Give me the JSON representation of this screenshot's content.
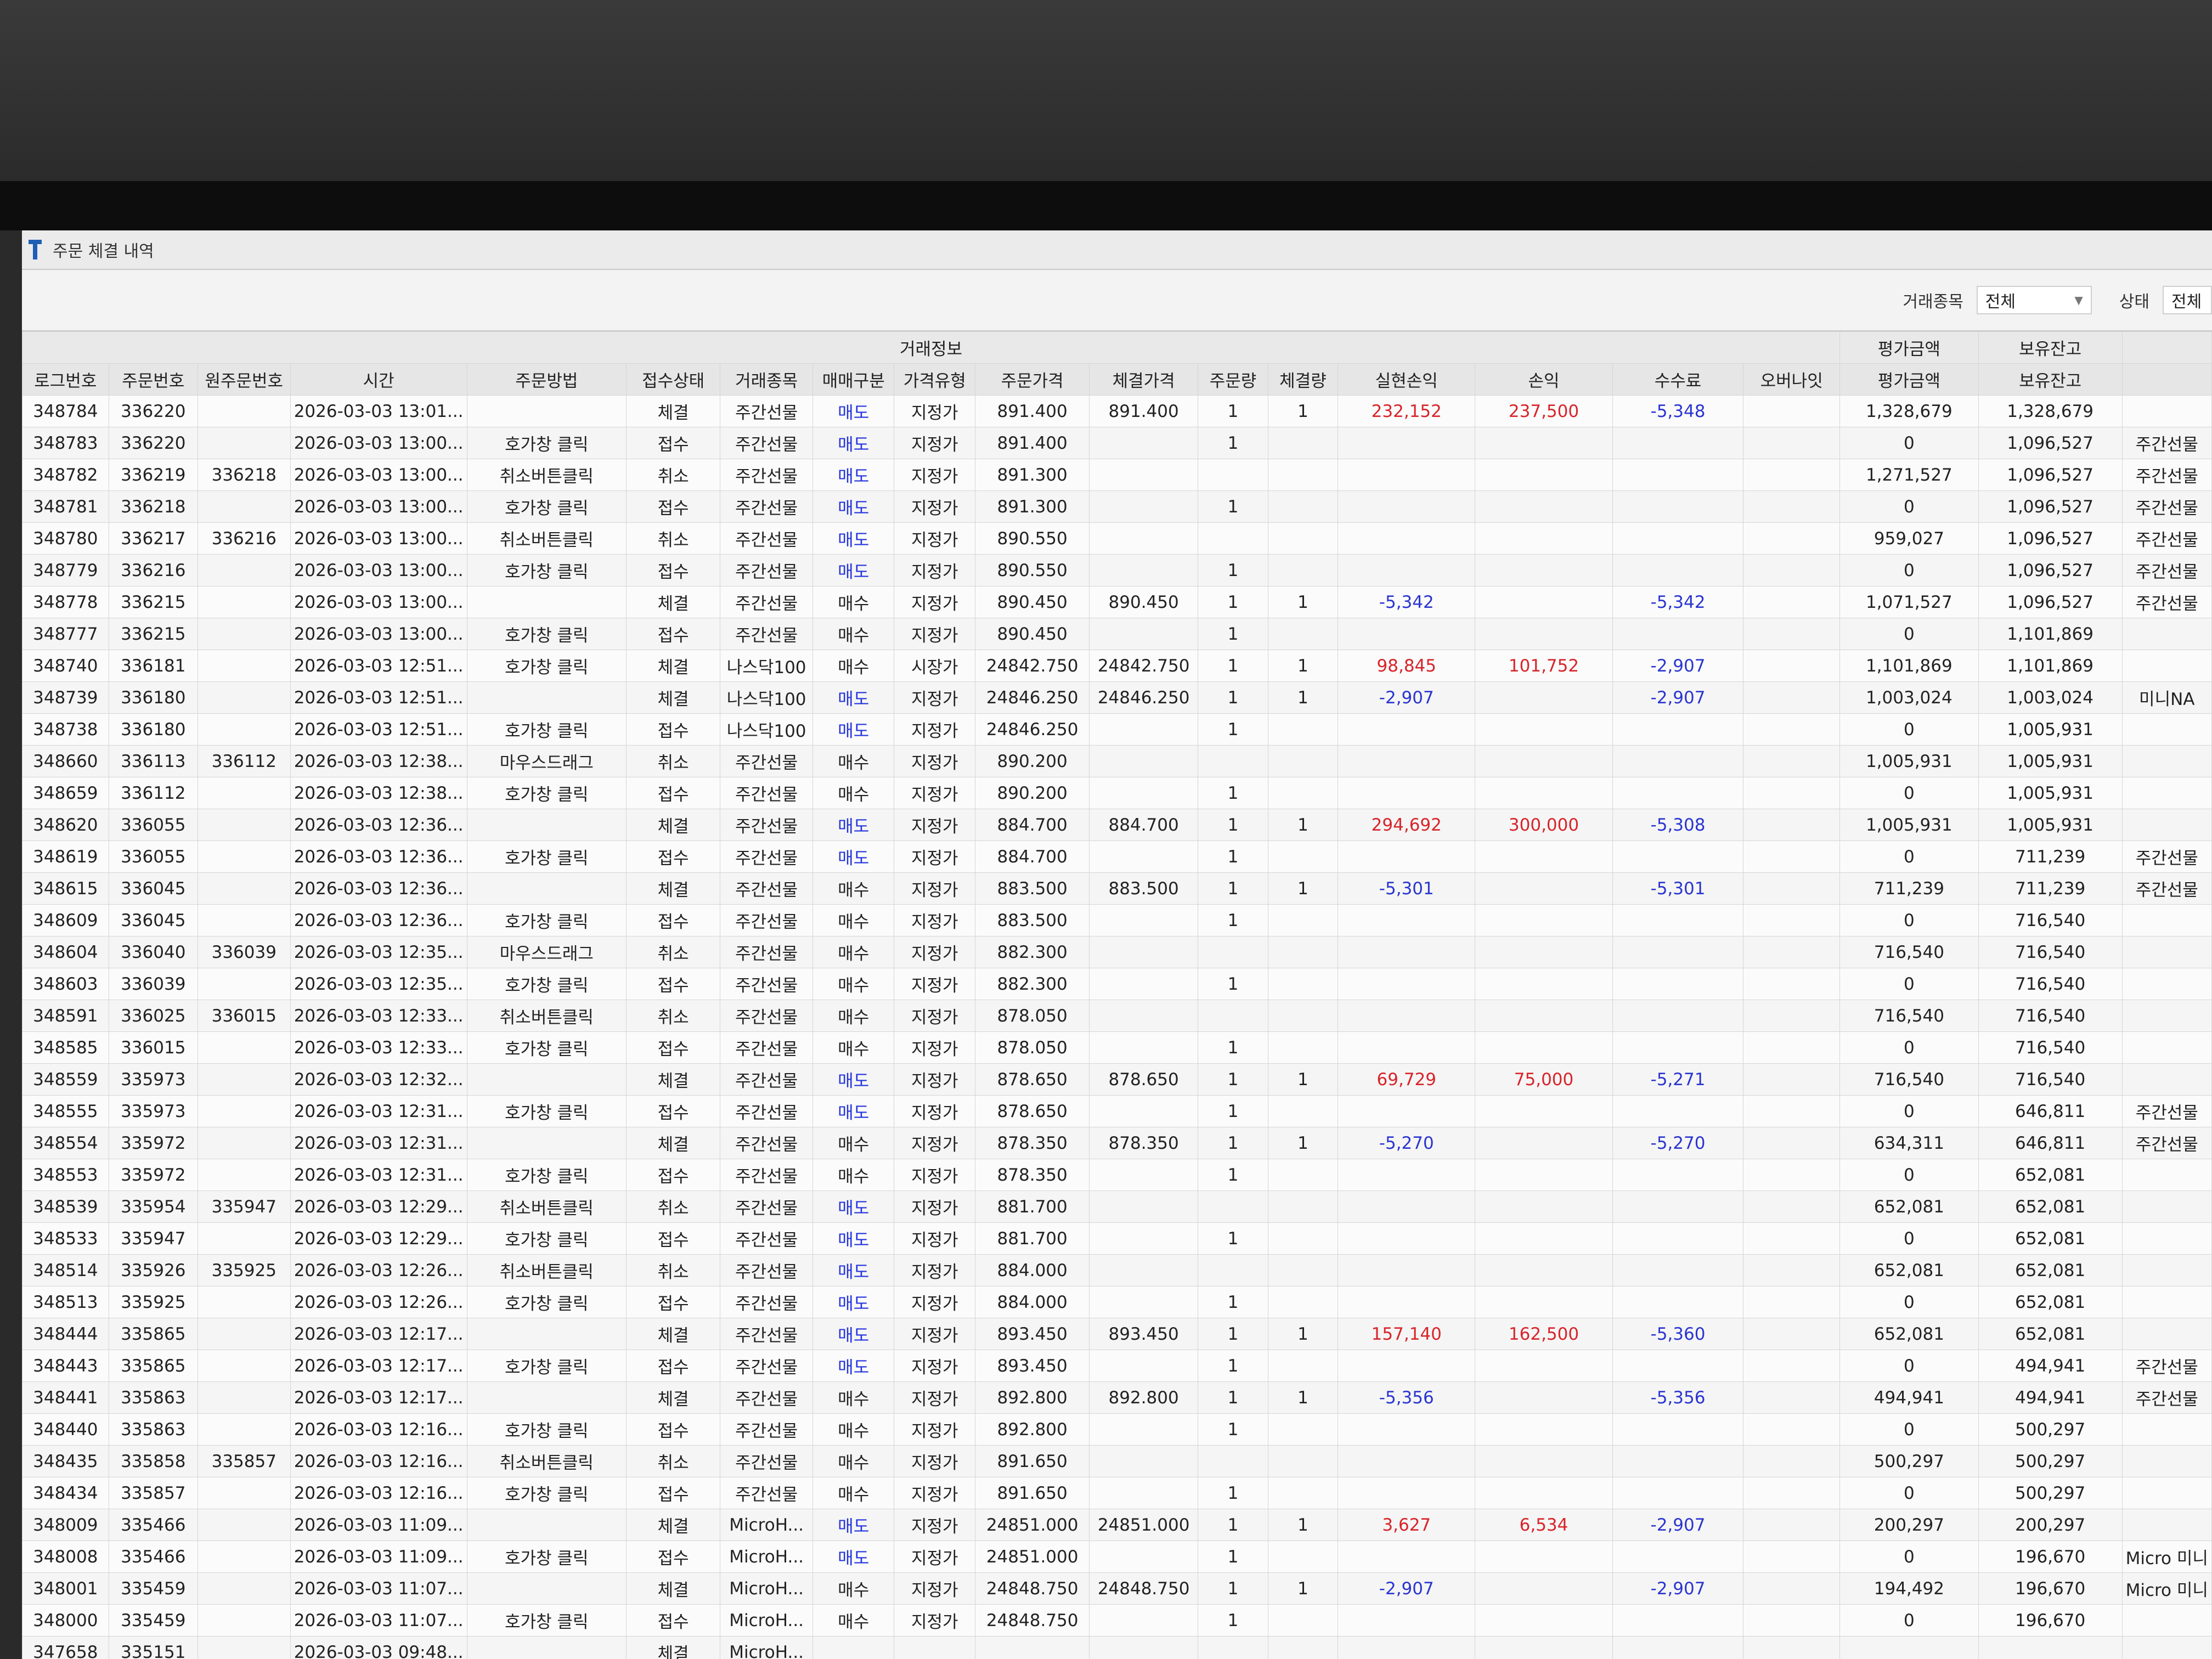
{
  "window": {
    "title": "주문 체결 내역"
  },
  "filters": {
    "item_label": "거래종목",
    "item_value": "전체",
    "status_label": "상태",
    "status_value": "전체"
  },
  "colors": {
    "sell": "#2233dd",
    "profit": "#d8242a",
    "loss": "#2a35d0"
  },
  "group_headers": {
    "trade_info": "거래정보",
    "eval_amount": "평가금액",
    "holding_balance": "보유잔고"
  },
  "columns": [
    "로그번호",
    "주문번호",
    "원주문번호",
    "시간",
    "주문방법",
    "접수상태",
    "거래종목",
    "매매구분",
    "가격유형",
    "주문가격",
    "체결가격",
    "주문량",
    "체결량",
    "실현손익",
    "손익",
    "수수료",
    "오버나잇",
    "평가금액",
    "보유잔고",
    ""
  ],
  "rows": [
    [
      "348784",
      "336220",
      "",
      "2026-03-03 13:01...",
      "",
      "체결",
      "주간선물",
      "매도",
      "지정가",
      "891.400",
      "891.400",
      "1",
      "1",
      "232,152",
      "237,500",
      "-5,348",
      "",
      "1,328,679",
      "1,328,679",
      ""
    ],
    [
      "348783",
      "336220",
      "",
      "2026-03-03 13:00...",
      "호가창 클릭",
      "접수",
      "주간선물",
      "매도",
      "지정가",
      "891.400",
      "",
      "1",
      "",
      "",
      "",
      "",
      "",
      "0",
      "1,096,527",
      "주간선물"
    ],
    [
      "348782",
      "336219",
      "336218",
      "2026-03-03 13:00...",
      "취소버튼클릭",
      "취소",
      "주간선물",
      "매도",
      "지정가",
      "891.300",
      "",
      "",
      "",
      "",
      "",
      "",
      "",
      "1,271,527",
      "1,096,527",
      "주간선물"
    ],
    [
      "348781",
      "336218",
      "",
      "2026-03-03 13:00...",
      "호가창 클릭",
      "접수",
      "주간선물",
      "매도",
      "지정가",
      "891.300",
      "",
      "1",
      "",
      "",
      "",
      "",
      "",
      "0",
      "1,096,527",
      "주간선물"
    ],
    [
      "348780",
      "336217",
      "336216",
      "2026-03-03 13:00...",
      "취소버튼클릭",
      "취소",
      "주간선물",
      "매도",
      "지정가",
      "890.550",
      "",
      "",
      "",
      "",
      "",
      "",
      "",
      "959,027",
      "1,096,527",
      "주간선물"
    ],
    [
      "348779",
      "336216",
      "",
      "2026-03-03 13:00...",
      "호가창 클릭",
      "접수",
      "주간선물",
      "매도",
      "지정가",
      "890.550",
      "",
      "1",
      "",
      "",
      "",
      "",
      "",
      "0",
      "1,096,527",
      "주간선물"
    ],
    [
      "348778",
      "336215",
      "",
      "2026-03-03 13:00...",
      "",
      "체결",
      "주간선물",
      "매수",
      "지정가",
      "890.450",
      "890.450",
      "1",
      "1",
      "-5,342",
      "",
      "-5,342",
      "",
      "1,071,527",
      "1,096,527",
      "주간선물"
    ],
    [
      "348777",
      "336215",
      "",
      "2026-03-03 13:00...",
      "호가창 클릭",
      "접수",
      "주간선물",
      "매수",
      "지정가",
      "890.450",
      "",
      "1",
      "",
      "",
      "",
      "",
      "",
      "0",
      "1,101,869",
      ""
    ],
    [
      "348740",
      "336181",
      "",
      "2026-03-03 12:51...",
      "호가창 클릭",
      "체결",
      "나스닥100",
      "매수",
      "시장가",
      "24842.750",
      "24842.750",
      "1",
      "1",
      "98,845",
      "101,752",
      "-2,907",
      "",
      "1,101,869",
      "1,101,869",
      ""
    ],
    [
      "348739",
      "336180",
      "",
      "2026-03-03 12:51...",
      "",
      "체결",
      "나스닥100",
      "매도",
      "지정가",
      "24846.250",
      "24846.250",
      "1",
      "1",
      "-2,907",
      "",
      "-2,907",
      "",
      "1,003,024",
      "1,003,024",
      "미니NA"
    ],
    [
      "348738",
      "336180",
      "",
      "2026-03-03 12:51...",
      "호가창 클릭",
      "접수",
      "나스닥100",
      "매도",
      "지정가",
      "24846.250",
      "",
      "1",
      "",
      "",
      "",
      "",
      "",
      "0",
      "1,005,931",
      ""
    ],
    [
      "348660",
      "336113",
      "336112",
      "2026-03-03 12:38...",
      "마우스드래그",
      "취소",
      "주간선물",
      "매수",
      "지정가",
      "890.200",
      "",
      "",
      "",
      "",
      "",
      "",
      "",
      "1,005,931",
      "1,005,931",
      ""
    ],
    [
      "348659",
      "336112",
      "",
      "2026-03-03 12:38...",
      "호가창 클릭",
      "접수",
      "주간선물",
      "매수",
      "지정가",
      "890.200",
      "",
      "1",
      "",
      "",
      "",
      "",
      "",
      "0",
      "1,005,931",
      ""
    ],
    [
      "348620",
      "336055",
      "",
      "2026-03-03 12:36...",
      "",
      "체결",
      "주간선물",
      "매도",
      "지정가",
      "884.700",
      "884.700",
      "1",
      "1",
      "294,692",
      "300,000",
      "-5,308",
      "",
      "1,005,931",
      "1,005,931",
      ""
    ],
    [
      "348619",
      "336055",
      "",
      "2026-03-03 12:36...",
      "호가창 클릭",
      "접수",
      "주간선물",
      "매도",
      "지정가",
      "884.700",
      "",
      "1",
      "",
      "",
      "",
      "",
      "",
      "0",
      "711,239",
      "주간선물"
    ],
    [
      "348615",
      "336045",
      "",
      "2026-03-03 12:36...",
      "",
      "체결",
      "주간선물",
      "매수",
      "지정가",
      "883.500",
      "883.500",
      "1",
      "1",
      "-5,301",
      "",
      "-5,301",
      "",
      "711,239",
      "711,239",
      "주간선물"
    ],
    [
      "348609",
      "336045",
      "",
      "2026-03-03 12:36...",
      "호가창 클릭",
      "접수",
      "주간선물",
      "매수",
      "지정가",
      "883.500",
      "",
      "1",
      "",
      "",
      "",
      "",
      "",
      "0",
      "716,540",
      ""
    ],
    [
      "348604",
      "336040",
      "336039",
      "2026-03-03 12:35...",
      "마우스드래그",
      "취소",
      "주간선물",
      "매수",
      "지정가",
      "882.300",
      "",
      "",
      "",
      "",
      "",
      "",
      "",
      "716,540",
      "716,540",
      ""
    ],
    [
      "348603",
      "336039",
      "",
      "2026-03-03 12:35...",
      "호가창 클릭",
      "접수",
      "주간선물",
      "매수",
      "지정가",
      "882.300",
      "",
      "1",
      "",
      "",
      "",
      "",
      "",
      "0",
      "716,540",
      ""
    ],
    [
      "348591",
      "336025",
      "336015",
      "2026-03-03 12:33...",
      "취소버튼클릭",
      "취소",
      "주간선물",
      "매수",
      "지정가",
      "878.050",
      "",
      "",
      "",
      "",
      "",
      "",
      "",
      "716,540",
      "716,540",
      ""
    ],
    [
      "348585",
      "336015",
      "",
      "2026-03-03 12:33...",
      "호가창 클릭",
      "접수",
      "주간선물",
      "매수",
      "지정가",
      "878.050",
      "",
      "1",
      "",
      "",
      "",
      "",
      "",
      "0",
      "716,540",
      ""
    ],
    [
      "348559",
      "335973",
      "",
      "2026-03-03 12:32...",
      "",
      "체결",
      "주간선물",
      "매도",
      "지정가",
      "878.650",
      "878.650",
      "1",
      "1",
      "69,729",
      "75,000",
      "-5,271",
      "",
      "716,540",
      "716,540",
      ""
    ],
    [
      "348555",
      "335973",
      "",
      "2026-03-03 12:31...",
      "호가창 클릭",
      "접수",
      "주간선물",
      "매도",
      "지정가",
      "878.650",
      "",
      "1",
      "",
      "",
      "",
      "",
      "",
      "0",
      "646,811",
      "주간선물"
    ],
    [
      "348554",
      "335972",
      "",
      "2026-03-03 12:31...",
      "",
      "체결",
      "주간선물",
      "매수",
      "지정가",
      "878.350",
      "878.350",
      "1",
      "1",
      "-5,270",
      "",
      "-5,270",
      "",
      "634,311",
      "646,811",
      "주간선물"
    ],
    [
      "348553",
      "335972",
      "",
      "2026-03-03 12:31...",
      "호가창 클릭",
      "접수",
      "주간선물",
      "매수",
      "지정가",
      "878.350",
      "",
      "1",
      "",
      "",
      "",
      "",
      "",
      "0",
      "652,081",
      ""
    ],
    [
      "348539",
      "335954",
      "335947",
      "2026-03-03 12:29...",
      "취소버튼클릭",
      "취소",
      "주간선물",
      "매도",
      "지정가",
      "881.700",
      "",
      "",
      "",
      "",
      "",
      "",
      "",
      "652,081",
      "652,081",
      ""
    ],
    [
      "348533",
      "335947",
      "",
      "2026-03-03 12:29...",
      "호가창 클릭",
      "접수",
      "주간선물",
      "매도",
      "지정가",
      "881.700",
      "",
      "1",
      "",
      "",
      "",
      "",
      "",
      "0",
      "652,081",
      ""
    ],
    [
      "348514",
      "335926",
      "335925",
      "2026-03-03 12:26...",
      "취소버튼클릭",
      "취소",
      "주간선물",
      "매도",
      "지정가",
      "884.000",
      "",
      "",
      "",
      "",
      "",
      "",
      "",
      "652,081",
      "652,081",
      ""
    ],
    [
      "348513",
      "335925",
      "",
      "2026-03-03 12:26...",
      "호가창 클릭",
      "접수",
      "주간선물",
      "매도",
      "지정가",
      "884.000",
      "",
      "1",
      "",
      "",
      "",
      "",
      "",
      "0",
      "652,081",
      ""
    ],
    [
      "348444",
      "335865",
      "",
      "2026-03-03 12:17...",
      "",
      "체결",
      "주간선물",
      "매도",
      "지정가",
      "893.450",
      "893.450",
      "1",
      "1",
      "157,140",
      "162,500",
      "-5,360",
      "",
      "652,081",
      "652,081",
      ""
    ],
    [
      "348443",
      "335865",
      "",
      "2026-03-03 12:17...",
      "호가창 클릭",
      "접수",
      "주간선물",
      "매도",
      "지정가",
      "893.450",
      "",
      "1",
      "",
      "",
      "",
      "",
      "",
      "0",
      "494,941",
      "주간선물"
    ],
    [
      "348441",
      "335863",
      "",
      "2026-03-03 12:17...",
      "",
      "체결",
      "주간선물",
      "매수",
      "지정가",
      "892.800",
      "892.800",
      "1",
      "1",
      "-5,356",
      "",
      "-5,356",
      "",
      "494,941",
      "494,941",
      "주간선물"
    ],
    [
      "348440",
      "335863",
      "",
      "2026-03-03 12:16...",
      "호가창 클릭",
      "접수",
      "주간선물",
      "매수",
      "지정가",
      "892.800",
      "",
      "1",
      "",
      "",
      "",
      "",
      "",
      "0",
      "500,297",
      ""
    ],
    [
      "348435",
      "335858",
      "335857",
      "2026-03-03 12:16...",
      "취소버튼클릭",
      "취소",
      "주간선물",
      "매수",
      "지정가",
      "891.650",
      "",
      "",
      "",
      "",
      "",
      "",
      "",
      "500,297",
      "500,297",
      ""
    ],
    [
      "348434",
      "335857",
      "",
      "2026-03-03 12:16...",
      "호가창 클릭",
      "접수",
      "주간선물",
      "매수",
      "지정가",
      "891.650",
      "",
      "1",
      "",
      "",
      "",
      "",
      "",
      "0",
      "500,297",
      ""
    ],
    [
      "348009",
      "335466",
      "",
      "2026-03-03 11:09...",
      "",
      "체결",
      "MicroH...",
      "매도",
      "지정가",
      "24851.000",
      "24851.000",
      "1",
      "1",
      "3,627",
      "6,534",
      "-2,907",
      "",
      "200,297",
      "200,297",
      ""
    ],
    [
      "348008",
      "335466",
      "",
      "2026-03-03 11:09...",
      "호가창 클릭",
      "접수",
      "MicroH...",
      "매도",
      "지정가",
      "24851.000",
      "",
      "1",
      "",
      "",
      "",
      "",
      "",
      "0",
      "196,670",
      "Micro 미니"
    ],
    [
      "348001",
      "335459",
      "",
      "2026-03-03 11:07...",
      "",
      "체결",
      "MicroH...",
      "매수",
      "지정가",
      "24848.750",
      "24848.750",
      "1",
      "1",
      "-2,907",
      "",
      "-2,907",
      "",
      "194,492",
      "196,670",
      "Micro 미니"
    ],
    [
      "348000",
      "335459",
      "",
      "2026-03-03 11:07...",
      "호가창 클릭",
      "접수",
      "MicroH...",
      "매수",
      "지정가",
      "24848.750",
      "",
      "1",
      "",
      "",
      "",
      "",
      "",
      "0",
      "196,670",
      ""
    ],
    [
      "347658",
      "335151",
      "",
      "2026-03-03 09:48...",
      "",
      "체결",
      "MicroH...",
      "",
      "",
      "",
      "",
      "",
      "",
      "",
      "",
      "",
      "",
      "",
      "",
      ""
    ]
  ]
}
